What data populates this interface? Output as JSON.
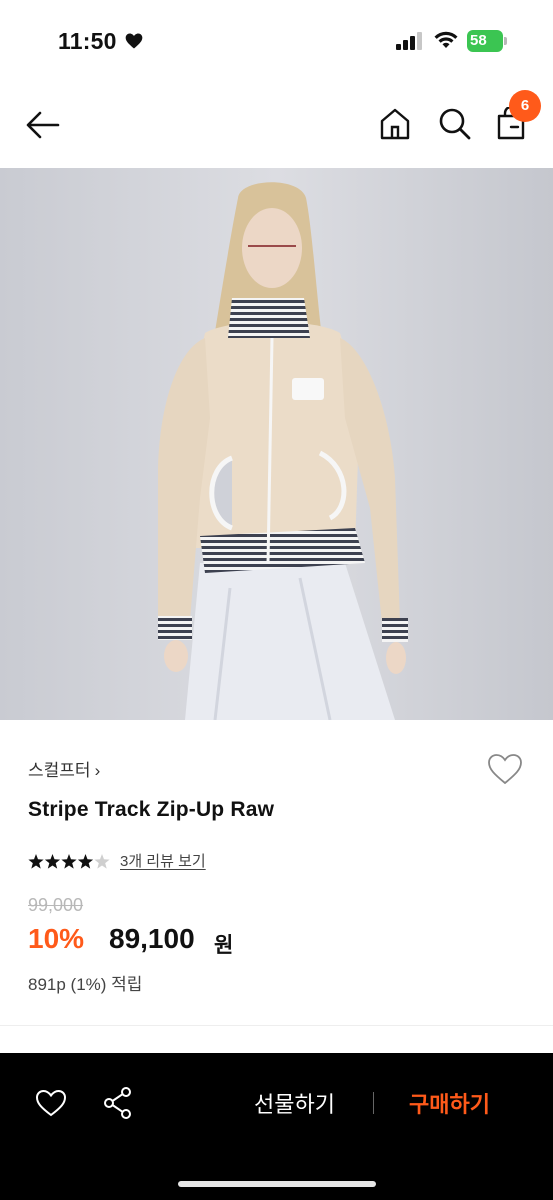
{
  "status_bar": {
    "time": "11:50",
    "battery": "58"
  },
  "nav": {
    "back_icon": "arrow-left-icon",
    "home_icon": "home-icon",
    "search_icon": "search-icon",
    "bag_icon": "shopping-bag-icon",
    "cart_count": "6"
  },
  "product": {
    "brand": "스컬프터",
    "brand_chevron": "›",
    "title": "Stripe Track Zip-Up Raw",
    "rating": 4.5,
    "review_link": "3개 리뷰 보기",
    "original_price": "99,000",
    "discount": "10%",
    "sale_price": "89,100",
    "sale_unit": "원",
    "points": "891p (1%) 적립"
  },
  "bottom_bar": {
    "gift_label": "선물하기",
    "buy_label": "구매하기"
  },
  "colors": {
    "accent": "#ff5a1a",
    "battery": "#3bc552",
    "bottom_bar": "#000000"
  }
}
